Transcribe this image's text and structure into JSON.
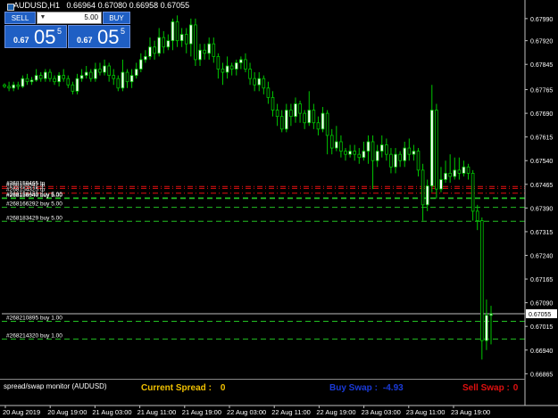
{
  "window": {
    "symbol": "AUDUSD,H1",
    "ohlc": "0.66964 0.67080 0.66958 0.67055"
  },
  "trade_panel": {
    "sell_label": "SELL",
    "buy_label": "BUY",
    "volume": "5.00",
    "sell_price": {
      "small": "0.67",
      "big": "05",
      "sup": "5"
    },
    "buy_price": {
      "small": "0.67",
      "big": "05",
      "sup": "5"
    }
  },
  "monitor": {
    "title": "spread/swap monitor (AUDUSD)",
    "current_spread_label": "Current Spread :",
    "current_spread_value": "0",
    "buy_swap_label": "Buy Swap :",
    "buy_swap_value": "-4.93",
    "sell_swap_label": "Sell Swap :",
    "sell_swap_value": "0"
  },
  "colors": {
    "background": "#000000",
    "bull_candle": "#ffffff",
    "bear_candle": "#000000",
    "wick": "#00c800",
    "order_line": "#22c022",
    "stop_line": "#e01010",
    "price_line": "#c0c0c0",
    "current_spread": "#f0c000",
    "buy_swap": "#1a3ad8",
    "sell_swap": "#e01010",
    "panel_button": "#1f5fc4"
  },
  "chart_data": {
    "type": "candlestick",
    "symbol": "AUDUSD",
    "timeframe": "H1",
    "ylim": [
      0.66849,
      0.68015
    ],
    "y_ticks": [
      "0.67990",
      "0.67920",
      "0.67845",
      "0.67765",
      "0.67690",
      "0.67615",
      "0.67540",
      "0.67465",
      "0.67390",
      "0.67315",
      "0.67240",
      "0.67165",
      "0.67090",
      "0.67015",
      "0.66940",
      "0.66865"
    ],
    "x_ticks": [
      "20 Aug 2019",
      "20 Aug 19:00",
      "21 Aug 03:00",
      "21 Aug 11:00",
      "21 Aug 19:00",
      "22 Aug 03:00",
      "22 Aug 11:00",
      "22 Aug 19:00",
      "23 Aug 03:00",
      "23 Aug 11:00",
      "23 Aug 19:00"
    ],
    "current_price": "0.67055",
    "candles": [
      [
        0.6778,
        0.67775,
        0.67785,
        0.6777
      ],
      [
        0.67775,
        0.6777,
        0.6779,
        0.6776
      ],
      [
        0.6777,
        0.6778,
        0.6779,
        0.6776
      ],
      [
        0.6778,
        0.67775,
        0.6779,
        0.67765
      ],
      [
        0.67775,
        0.678,
        0.6781,
        0.6777
      ],
      [
        0.678,
        0.6779,
        0.67815,
        0.6778
      ],
      [
        0.6779,
        0.67795,
        0.67805,
        0.6778
      ],
      [
        0.67795,
        0.6781,
        0.6783,
        0.6779
      ],
      [
        0.6781,
        0.678,
        0.6782,
        0.6779
      ],
      [
        0.678,
        0.6782,
        0.6783,
        0.6779
      ],
      [
        0.6782,
        0.678,
        0.6783,
        0.6779
      ],
      [
        0.678,
        0.6779,
        0.6781,
        0.6778
      ],
      [
        0.6779,
        0.6781,
        0.6782,
        0.67775
      ],
      [
        0.6781,
        0.678,
        0.6783,
        0.6779
      ],
      [
        0.678,
        0.6778,
        0.6781,
        0.6777
      ],
      [
        0.6778,
        0.6776,
        0.6779,
        0.6775
      ],
      [
        0.6776,
        0.678,
        0.67815,
        0.6775
      ],
      [
        0.678,
        0.6781,
        0.6783,
        0.6779
      ],
      [
        0.6781,
        0.6782,
        0.6784,
        0.678
      ],
      [
        0.6782,
        0.678,
        0.6783,
        0.6779
      ],
      [
        0.678,
        0.6783,
        0.6785,
        0.6779
      ],
      [
        0.6783,
        0.6782,
        0.6785,
        0.6781
      ],
      [
        0.6782,
        0.6784,
        0.6786,
        0.6781
      ],
      [
        0.6784,
        0.6781,
        0.6785,
        0.6779
      ],
      [
        0.6781,
        0.678,
        0.6783,
        0.6778
      ],
      [
        0.678,
        0.6777,
        0.6781,
        0.6776
      ],
      [
        0.6777,
        0.6782,
        0.6786,
        0.6776
      ],
      [
        0.6782,
        0.6779,
        0.6783,
        0.6777
      ],
      [
        0.6779,
        0.6781,
        0.6783,
        0.6777
      ],
      [
        0.6781,
        0.6783,
        0.6785,
        0.678
      ],
      [
        0.6783,
        0.6786,
        0.6788,
        0.6782
      ],
      [
        0.6786,
        0.6787,
        0.6789,
        0.6785
      ],
      [
        0.6787,
        0.679,
        0.6793,
        0.6786
      ],
      [
        0.679,
        0.6788,
        0.6792,
        0.6786
      ],
      [
        0.6788,
        0.6793,
        0.6796,
        0.6787
      ],
      [
        0.6793,
        0.679,
        0.6795,
        0.6788
      ],
      [
        0.679,
        0.6792,
        0.6794,
        0.6789
      ],
      [
        0.6792,
        0.6798,
        0.6799,
        0.6789
      ],
      [
        0.6798,
        0.6792,
        0.68,
        0.679
      ],
      [
        0.6792,
        0.6794,
        0.6796,
        0.679
      ],
      [
        0.6794,
        0.6791,
        0.6796,
        0.6788
      ],
      [
        0.6791,
        0.6797,
        0.6799,
        0.6787
      ],
      [
        0.6797,
        0.6786,
        0.6799,
        0.6784
      ],
      [
        0.6786,
        0.6789,
        0.6791,
        0.6784
      ],
      [
        0.6789,
        0.6788,
        0.6791,
        0.6786
      ],
      [
        0.6788,
        0.6791,
        0.6793,
        0.6786
      ],
      [
        0.6791,
        0.6787,
        0.6793,
        0.6785
      ],
      [
        0.6787,
        0.6783,
        0.6788,
        0.678
      ],
      [
        0.6783,
        0.6782,
        0.6785,
        0.6778
      ],
      [
        0.6782,
        0.6784,
        0.6787,
        0.678
      ],
      [
        0.6784,
        0.6783,
        0.6785,
        0.6781
      ],
      [
        0.6783,
        0.6785,
        0.6786,
        0.6781
      ],
      [
        0.6785,
        0.6786,
        0.6787,
        0.6783
      ],
      [
        0.6786,
        0.6783,
        0.6788,
        0.6782
      ],
      [
        0.6783,
        0.678,
        0.6785,
        0.6778
      ],
      [
        0.678,
        0.6778,
        0.6782,
        0.6776
      ],
      [
        0.6778,
        0.678,
        0.6782,
        0.6776
      ],
      [
        0.678,
        0.6777,
        0.6781,
        0.6775
      ],
      [
        0.6777,
        0.6774,
        0.6779,
        0.6772
      ],
      [
        0.6774,
        0.677,
        0.6776,
        0.6768
      ],
      [
        0.677,
        0.6768,
        0.6772,
        0.6765
      ],
      [
        0.6768,
        0.6764,
        0.677,
        0.6763
      ],
      [
        0.6764,
        0.677,
        0.6772,
        0.6763
      ],
      [
        0.677,
        0.6768,
        0.6772,
        0.6765
      ],
      [
        0.6768,
        0.6772,
        0.6774,
        0.6766
      ],
      [
        0.6772,
        0.6769,
        0.6773,
        0.6766
      ],
      [
        0.6769,
        0.6766,
        0.677,
        0.6764
      ],
      [
        0.6766,
        0.677,
        0.6776,
        0.6765
      ],
      [
        0.677,
        0.6766,
        0.6772,
        0.6764
      ],
      [
        0.6766,
        0.6764,
        0.6768,
        0.6762
      ],
      [
        0.6764,
        0.6769,
        0.6771,
        0.6763
      ],
      [
        0.6769,
        0.6762,
        0.677,
        0.6756
      ],
      [
        0.6762,
        0.6758,
        0.6764,
        0.6756
      ],
      [
        0.6758,
        0.676,
        0.6765,
        0.6757
      ],
      [
        0.676,
        0.6757,
        0.6762,
        0.6755
      ],
      [
        0.6757,
        0.6756,
        0.6758,
        0.6754
      ],
      [
        0.6756,
        0.6757,
        0.6759,
        0.6755
      ],
      [
        0.6757,
        0.6756,
        0.6759,
        0.6754
      ],
      [
        0.6756,
        0.6755,
        0.6758,
        0.6753
      ],
      [
        0.6755,
        0.6757,
        0.676,
        0.6754
      ],
      [
        0.6757,
        0.676,
        0.6762,
        0.6753
      ],
      [
        0.676,
        0.6754,
        0.6762,
        0.6745
      ],
      [
        0.6754,
        0.6757,
        0.6759,
        0.6752
      ],
      [
        0.6757,
        0.6759,
        0.6762,
        0.6755
      ],
      [
        0.6759,
        0.6756,
        0.6761,
        0.6754
      ],
      [
        0.6756,
        0.6752,
        0.6758,
        0.675
      ],
      [
        0.6752,
        0.6756,
        0.6758,
        0.675
      ],
      [
        0.6756,
        0.6754,
        0.6757,
        0.6752
      ],
      [
        0.6754,
        0.6758,
        0.676,
        0.6752
      ],
      [
        0.6758,
        0.6756,
        0.6761,
        0.6754
      ],
      [
        0.6756,
        0.6757,
        0.6759,
        0.6754
      ],
      [
        0.6757,
        0.6751,
        0.6758,
        0.6749
      ],
      [
        0.6751,
        0.674,
        0.6753,
        0.6735
      ],
      [
        0.674,
        0.6746,
        0.6748,
        0.6738
      ],
      [
        0.6746,
        0.677,
        0.6778,
        0.6744
      ],
      [
        0.677,
        0.6745,
        0.6772,
        0.6742
      ],
      [
        0.6745,
        0.6748,
        0.6752,
        0.6744
      ],
      [
        0.6748,
        0.675,
        0.6754,
        0.6747
      ],
      [
        0.675,
        0.6749,
        0.6756,
        0.6747
      ],
      [
        0.6749,
        0.6751,
        0.6755,
        0.6748
      ],
      [
        0.6751,
        0.675,
        0.6755,
        0.6748
      ],
      [
        0.675,
        0.6752,
        0.6754,
        0.6749
      ],
      [
        0.6752,
        0.675,
        0.6753,
        0.6748
      ],
      [
        0.675,
        0.6738,
        0.6751,
        0.6735
      ],
      [
        0.6738,
        0.6735,
        0.674,
        0.6732
      ],
      [
        0.6735,
        0.6697,
        0.6736,
        0.6691
      ],
      [
        0.6697,
        0.6705,
        0.671,
        0.6694
      ],
      [
        0.6705,
        0.67055,
        0.6708,
        0.66958
      ]
    ],
    "levels": [
      {
        "label": "#268158465 tp",
        "price": 0.67458,
        "kind": "tp"
      },
      {
        "label": "#268155542 tp",
        "price": 0.67452,
        "kind": "tp"
      },
      {
        "label": "#268154325 tp",
        "price": 0.67437,
        "kind": "tp"
      },
      {
        "label": "#268158489 buy 5.00",
        "price": 0.67422,
        "kind": "order"
      },
      {
        "label": "#268156040 buy 5.00",
        "price": 0.6742,
        "kind": "order"
      },
      {
        "label": "#268166292 buy 5.00",
        "price": 0.67392,
        "kind": "order"
      },
      {
        "label": "#268183429 buy 5.00",
        "price": 0.67348,
        "kind": "order"
      },
      {
        "label": "#268210895 buy 1.00",
        "price": 0.67031,
        "kind": "order"
      },
      {
        "label": "#268214320 buy 1.00",
        "price": 0.66975,
        "kind": "order"
      }
    ]
  }
}
